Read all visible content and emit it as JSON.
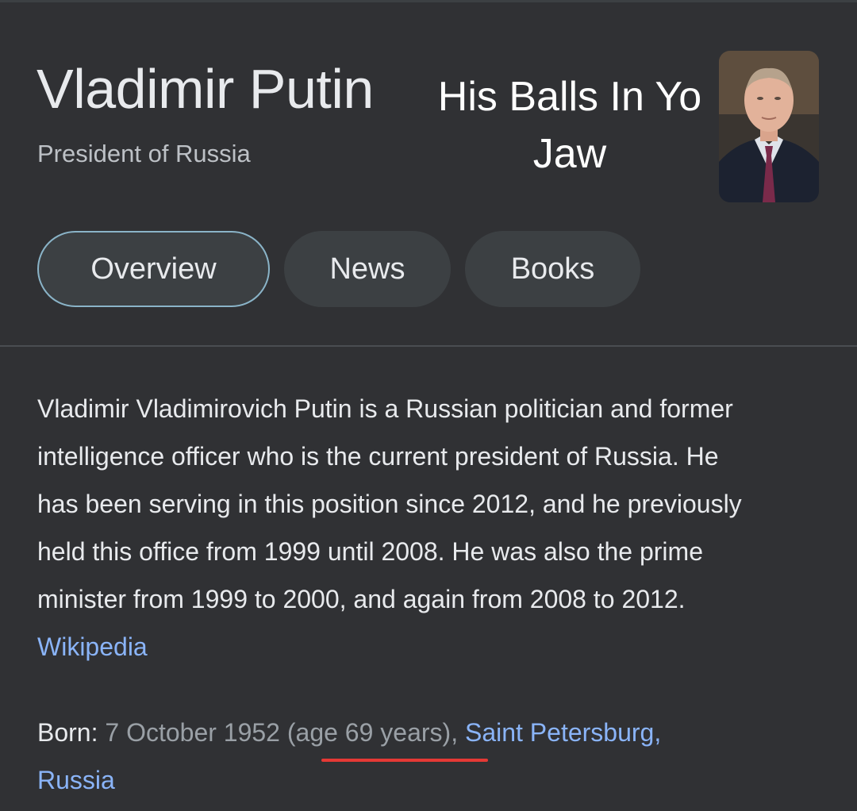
{
  "entity": {
    "title": "Vladimir Putin",
    "subtitle": "President of Russia",
    "image_alt": "Vladimir Putin photo"
  },
  "overlay_caption": {
    "line1": "His Balls In Yo",
    "line2": "Jaw"
  },
  "tabs": [
    {
      "label": "Overview",
      "active": true
    },
    {
      "label": "News",
      "active": false
    },
    {
      "label": "Books",
      "active": false
    }
  ],
  "description": {
    "lines": [
      "Vladimir Vladimirovich Putin is a Russian politician and former",
      "intelligence officer who is the current president of Russia.  He",
      "has been serving in this position since 2012,  and he previously",
      "held this office from 1999 until 2008.  He was also the prime",
      "minister from 1999 to 2000,  and again from 2008 to 2012."
    ],
    "source_link": "Wikipedia"
  },
  "born": {
    "label": "Born",
    "separator": ": ",
    "date": "7 October 1952 ",
    "age": "(age 69 years)",
    "comma": ",  ",
    "place_line1": "Saint Petersburg,",
    "place_line2": "Russia"
  },
  "colors": {
    "background": "#303134",
    "link": "#8ab4f8",
    "underline": "#e53935",
    "active_tab_border": "#8ab4c8"
  }
}
